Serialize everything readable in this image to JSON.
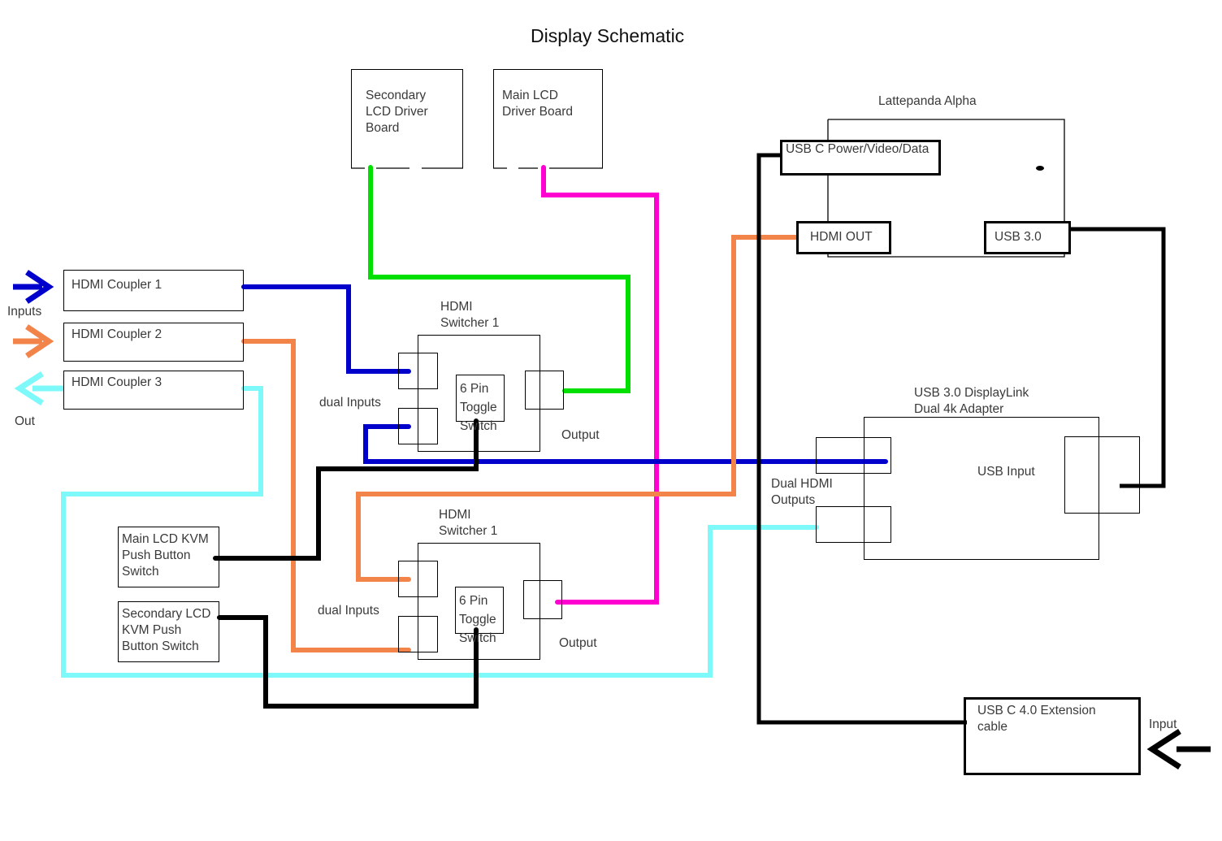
{
  "title": "Display Schematic",
  "colors": {
    "blue": "#0000CC",
    "orange": "#F2844A",
    "cyan": "#7DF9F9",
    "green": "#00E000",
    "magenta": "#FF00D0",
    "black": "#000000",
    "text": "#3a3a3a"
  },
  "blocks": {
    "secondary_lcd_driver": "Secondary\nLCD Driver\nBoard",
    "main_lcd_driver": "Main LCD\nDriver Board",
    "hdmi_coupler_1": "HDMI Coupler 1",
    "hdmi_coupler_2": "HDMI Coupler 2",
    "hdmi_coupler_3": "HDMI Coupler 3",
    "hdmi_switcher_top": "HDMI\nSwitcher 1",
    "hdmi_switcher_bottom": "HDMI\nSwitcher 1",
    "toggle_switch_top": "6 Pin\nToggle\nSwitch",
    "toggle_switch_bottom": "6 Pin\nToggle\nSwitch",
    "main_lcd_kvm": "Main LCD KVM\nPush Button\nSwitch",
    "secondary_lcd_kvm": "Secondary LCD\nKVM Push\nButton Switch",
    "lattepanda_alpha": "Lattepanda Alpha",
    "usb_c_power": "USB C Power/Video/Data",
    "hdmi_out": "HDMI OUT",
    "usb_3_0": "USB 3.0",
    "displaylink_adapter": "USB 3.0 DisplayLink\nDual 4k Adapter",
    "usb_input": "USB Input",
    "usb_c_extension": "USB C 4.0 Extension\ncable"
  },
  "labels": {
    "inputs": "Inputs",
    "out": "Out",
    "dual_inputs_top": "dual Inputs",
    "dual_inputs_bottom": "dual Inputs",
    "output_top": "Output",
    "output_bottom": "Output",
    "dual_hdmi_outputs": "Dual HDMI\nOutputs",
    "input_right": "Input"
  }
}
